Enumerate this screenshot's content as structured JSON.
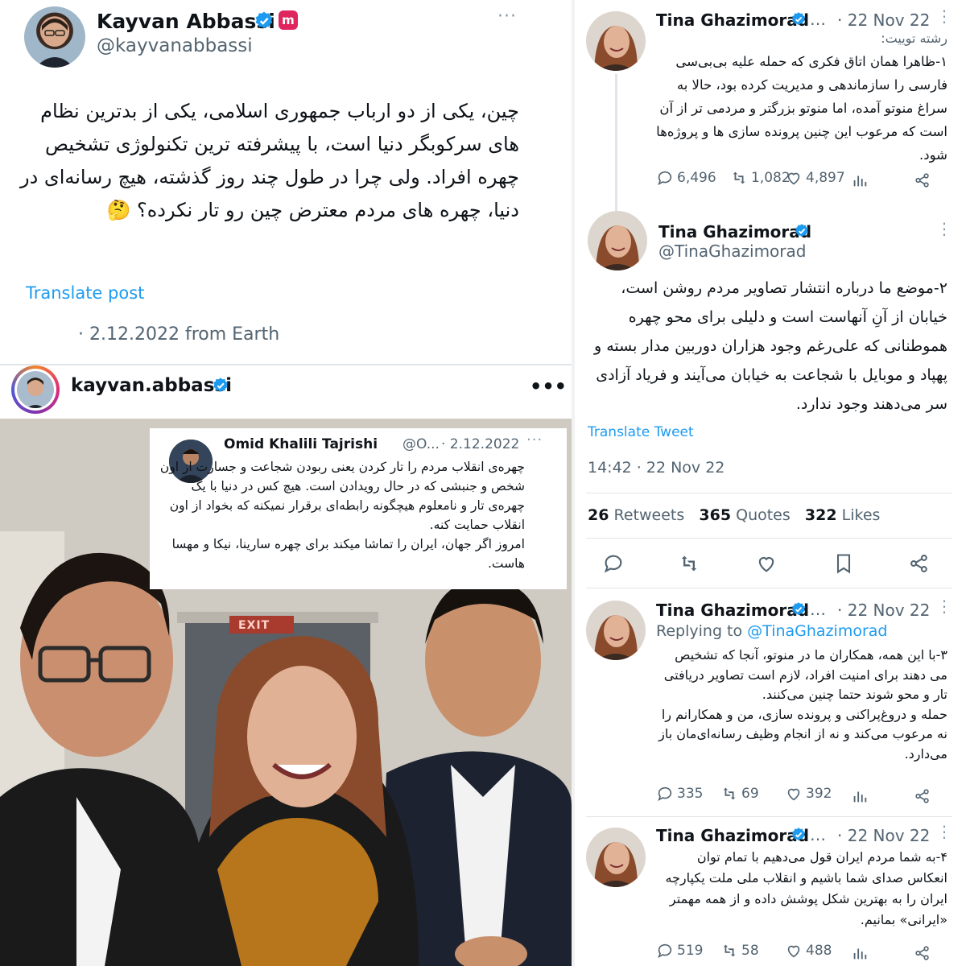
{
  "left": {
    "tweet": {
      "name": "Kayvan Abbassi",
      "handle": "@kayvanabbassi",
      "body": "چین، یکی از دو ارباب جمهوری اسلامی، یکی از بدترین نظام های سرکوبگر دنیا است، با پیشرفته ترین تکنولوژی تشخیص چهره افراد. ولی چرا در طول چند روز گذشته، هیچ رسانه‌ای در دنیا، چهره های مردم معترض چین رو تار نکرده؟ 🤔",
      "translate": "Translate post",
      "meta": "· 2.12.2022 from Earth"
    },
    "instagram": {
      "username": "kayvan.abbassi",
      "embedded": {
        "name": "Omid Khalili Tajrishi",
        "handle": "@O...",
        "date": "· 2.12.2022",
        "body": "چهره‌ی انقلاب مردم را تار کردن یعنی ربودن شجاعت و جسارت از اون شخص و جنبشی که در حال رویدادن است. هیچ کس در دنیا با یک چهره‌ی تار و نامعلوم هیچگونه رابطه‌ای برقرار نمیکنه که بخواد از اون انقلاب حمایت کنه.\nامروز اگر جهان، ایران را تماشا میکند برای چهره سارینا، نیکا و مهسا هاست."
      },
      "exit_sign": "EXIT"
    }
  },
  "right": {
    "t1": {
      "name": "Tina Ghazimorad",
      "date": "· 22 Nov 22",
      "thread_label": "رشته توییت:",
      "body": "۱-ظاهرا همان اتاق فکری که حمله علیه بی‌بی‌سی فارسی را سازماندهی و مدیریت کرده بود، حالا به سراغ منوتو آمده، اما منوتو بزرگتر و مردمی تر از آن است که مرعوب این چنین پرونده سازی ها و پروژه‌ها شود.",
      "replies": "6,496",
      "retweets": "1,082",
      "likes": "4,897"
    },
    "t2": {
      "name": "Tina Ghazimorad",
      "handle": "@TinaGhazimorad",
      "body": "۲-موضع ما درباره انتشار تصاویر مردم روشن است، خیابان از آنِ آنهاست است و دلیلی برای محو چهره هموطنانی که علی‌رغم وجود هزاران دوربین مدار بسته و پهپاد و موبایل با شجاعت به خیابان می‌آیند و فریاد آزادی سر می‌دهند وجود ندارد.",
      "translate": "Translate Tweet",
      "timestamp": "14:42 · 22 Nov 22",
      "retweets_count": "26",
      "retweets_label": "Retweets",
      "quotes_count": "365",
      "quotes_label": "Quotes",
      "likes_count": "322",
      "likes_label": "Likes"
    },
    "t3": {
      "name": "Tina Ghazimorad",
      "date": "· 22 Nov 22",
      "replying_prefix": "Replying to",
      "replying_handle": "@TinaGhazimorad",
      "body": "۳-با این همه، همکاران ما در منوتو، آنجا که تشخیص می دهند برای امنیت افراد، لازم است تصاویر دریافتی تار و محو شوند حتما چنین می‌کنند.\nحمله و دروغ‌پراکنی و پرونده سازی، من و همکارانم را نه مرعوب می‌کند و نه از انجام وظیف رسانه‌ای‌مان باز می‌دارد.",
      "replies": "335",
      "retweets": "69",
      "likes": "392"
    },
    "t4": {
      "name": "Tina Ghazimorad",
      "date": "· 22 Nov 22",
      "body": "۴-به شما مردم ایران قول می‌دهیم با تمام توان انعکاس صدای شما باشیم و انقلاب ملی ملت یکپارچه ایران را به بهترین شکل پوشش داده و از همه مهمتر «ایرانی» بمانیم.",
      "replies": "519",
      "retweets": "58",
      "likes": "488"
    }
  },
  "colors": {
    "blue": "#1d9bf0",
    "muted": "#536471",
    "text": "#0f1419",
    "badge_pink": "#e0245e"
  }
}
